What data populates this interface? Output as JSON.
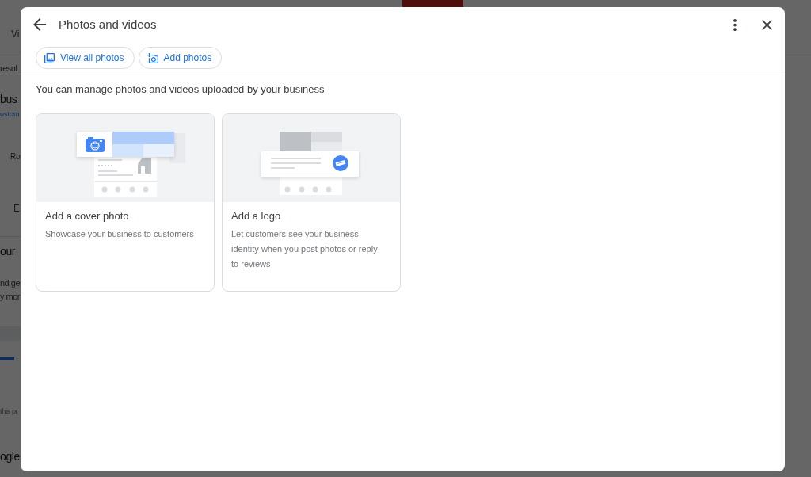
{
  "background": {
    "texts": [
      {
        "text": "Vi",
        "kind": "tab"
      },
      {
        "text": "resul",
        "kind": "label"
      },
      {
        "text": "bus",
        "kind": "heading"
      },
      {
        "text": "ustom",
        "kind": "link"
      },
      {
        "text": "Ro",
        "kind": "small"
      },
      {
        "text": "E",
        "kind": "tab"
      },
      {
        "text": "our",
        "kind": "heading"
      },
      {
        "text": "nd ge",
        "kind": "label"
      },
      {
        "text": "y mor",
        "kind": "label"
      },
      {
        "text": "this pr",
        "kind": "caption"
      },
      {
        "text": "ogle",
        "kind": "heading"
      }
    ]
  },
  "dialog": {
    "title": "Photos and videos",
    "actions": [
      {
        "label": "View all photos",
        "kind": "gallery"
      },
      {
        "label": "Add photos",
        "kind": "add"
      }
    ],
    "subtitle": "You can manage photos and videos uploaded by your business",
    "cards": [
      {
        "kind": "cover",
        "title": "Add a cover photo",
        "description": "Showcase your business to customers"
      },
      {
        "kind": "logo",
        "title": "Add a logo",
        "description": "Let customers see your business identity when you post photos or reply to reviews"
      }
    ]
  }
}
